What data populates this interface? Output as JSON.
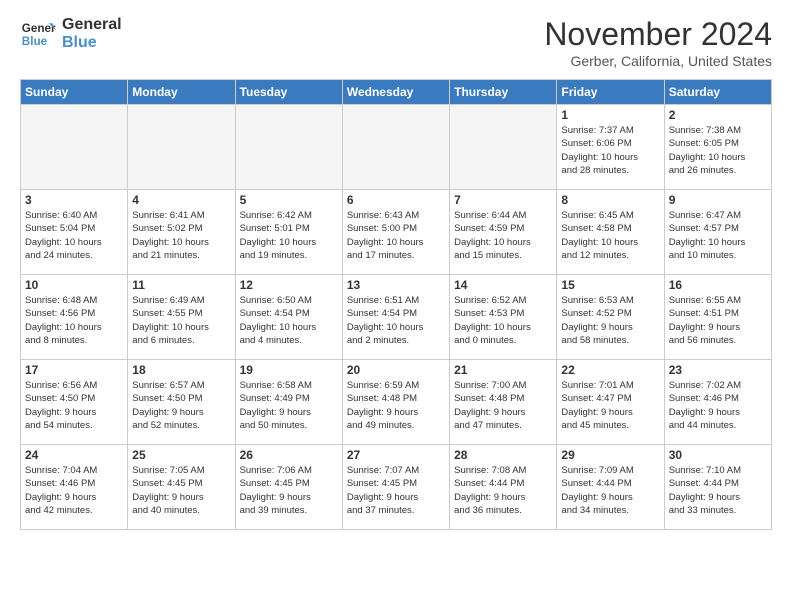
{
  "header": {
    "logo_line1": "General",
    "logo_line2": "Blue",
    "month": "November 2024",
    "location": "Gerber, California, United States"
  },
  "days_of_week": [
    "Sunday",
    "Monday",
    "Tuesday",
    "Wednesday",
    "Thursday",
    "Friday",
    "Saturday"
  ],
  "weeks": [
    [
      {
        "day": "",
        "info": ""
      },
      {
        "day": "",
        "info": ""
      },
      {
        "day": "",
        "info": ""
      },
      {
        "day": "",
        "info": ""
      },
      {
        "day": "",
        "info": ""
      },
      {
        "day": "1",
        "info": "Sunrise: 7:37 AM\nSunset: 6:06 PM\nDaylight: 10 hours\nand 28 minutes."
      },
      {
        "day": "2",
        "info": "Sunrise: 7:38 AM\nSunset: 6:05 PM\nDaylight: 10 hours\nand 26 minutes."
      }
    ],
    [
      {
        "day": "3",
        "info": "Sunrise: 6:40 AM\nSunset: 5:04 PM\nDaylight: 10 hours\nand 24 minutes."
      },
      {
        "day": "4",
        "info": "Sunrise: 6:41 AM\nSunset: 5:02 PM\nDaylight: 10 hours\nand 21 minutes."
      },
      {
        "day": "5",
        "info": "Sunrise: 6:42 AM\nSunset: 5:01 PM\nDaylight: 10 hours\nand 19 minutes."
      },
      {
        "day": "6",
        "info": "Sunrise: 6:43 AM\nSunset: 5:00 PM\nDaylight: 10 hours\nand 17 minutes."
      },
      {
        "day": "7",
        "info": "Sunrise: 6:44 AM\nSunset: 4:59 PM\nDaylight: 10 hours\nand 15 minutes."
      },
      {
        "day": "8",
        "info": "Sunrise: 6:45 AM\nSunset: 4:58 PM\nDaylight: 10 hours\nand 12 minutes."
      },
      {
        "day": "9",
        "info": "Sunrise: 6:47 AM\nSunset: 4:57 PM\nDaylight: 10 hours\nand 10 minutes."
      }
    ],
    [
      {
        "day": "10",
        "info": "Sunrise: 6:48 AM\nSunset: 4:56 PM\nDaylight: 10 hours\nand 8 minutes."
      },
      {
        "day": "11",
        "info": "Sunrise: 6:49 AM\nSunset: 4:55 PM\nDaylight: 10 hours\nand 6 minutes."
      },
      {
        "day": "12",
        "info": "Sunrise: 6:50 AM\nSunset: 4:54 PM\nDaylight: 10 hours\nand 4 minutes."
      },
      {
        "day": "13",
        "info": "Sunrise: 6:51 AM\nSunset: 4:54 PM\nDaylight: 10 hours\nand 2 minutes."
      },
      {
        "day": "14",
        "info": "Sunrise: 6:52 AM\nSunset: 4:53 PM\nDaylight: 10 hours\nand 0 minutes."
      },
      {
        "day": "15",
        "info": "Sunrise: 6:53 AM\nSunset: 4:52 PM\nDaylight: 9 hours\nand 58 minutes."
      },
      {
        "day": "16",
        "info": "Sunrise: 6:55 AM\nSunset: 4:51 PM\nDaylight: 9 hours\nand 56 minutes."
      }
    ],
    [
      {
        "day": "17",
        "info": "Sunrise: 6:56 AM\nSunset: 4:50 PM\nDaylight: 9 hours\nand 54 minutes."
      },
      {
        "day": "18",
        "info": "Sunrise: 6:57 AM\nSunset: 4:50 PM\nDaylight: 9 hours\nand 52 minutes."
      },
      {
        "day": "19",
        "info": "Sunrise: 6:58 AM\nSunset: 4:49 PM\nDaylight: 9 hours\nand 50 minutes."
      },
      {
        "day": "20",
        "info": "Sunrise: 6:59 AM\nSunset: 4:48 PM\nDaylight: 9 hours\nand 49 minutes."
      },
      {
        "day": "21",
        "info": "Sunrise: 7:00 AM\nSunset: 4:48 PM\nDaylight: 9 hours\nand 47 minutes."
      },
      {
        "day": "22",
        "info": "Sunrise: 7:01 AM\nSunset: 4:47 PM\nDaylight: 9 hours\nand 45 minutes."
      },
      {
        "day": "23",
        "info": "Sunrise: 7:02 AM\nSunset: 4:46 PM\nDaylight: 9 hours\nand 44 minutes."
      }
    ],
    [
      {
        "day": "24",
        "info": "Sunrise: 7:04 AM\nSunset: 4:46 PM\nDaylight: 9 hours\nand 42 minutes."
      },
      {
        "day": "25",
        "info": "Sunrise: 7:05 AM\nSunset: 4:45 PM\nDaylight: 9 hours\nand 40 minutes."
      },
      {
        "day": "26",
        "info": "Sunrise: 7:06 AM\nSunset: 4:45 PM\nDaylight: 9 hours\nand 39 minutes."
      },
      {
        "day": "27",
        "info": "Sunrise: 7:07 AM\nSunset: 4:45 PM\nDaylight: 9 hours\nand 37 minutes."
      },
      {
        "day": "28",
        "info": "Sunrise: 7:08 AM\nSunset: 4:44 PM\nDaylight: 9 hours\nand 36 minutes."
      },
      {
        "day": "29",
        "info": "Sunrise: 7:09 AM\nSunset: 4:44 PM\nDaylight: 9 hours\nand 34 minutes."
      },
      {
        "day": "30",
        "info": "Sunrise: 7:10 AM\nSunset: 4:44 PM\nDaylight: 9 hours\nand 33 minutes."
      }
    ]
  ]
}
